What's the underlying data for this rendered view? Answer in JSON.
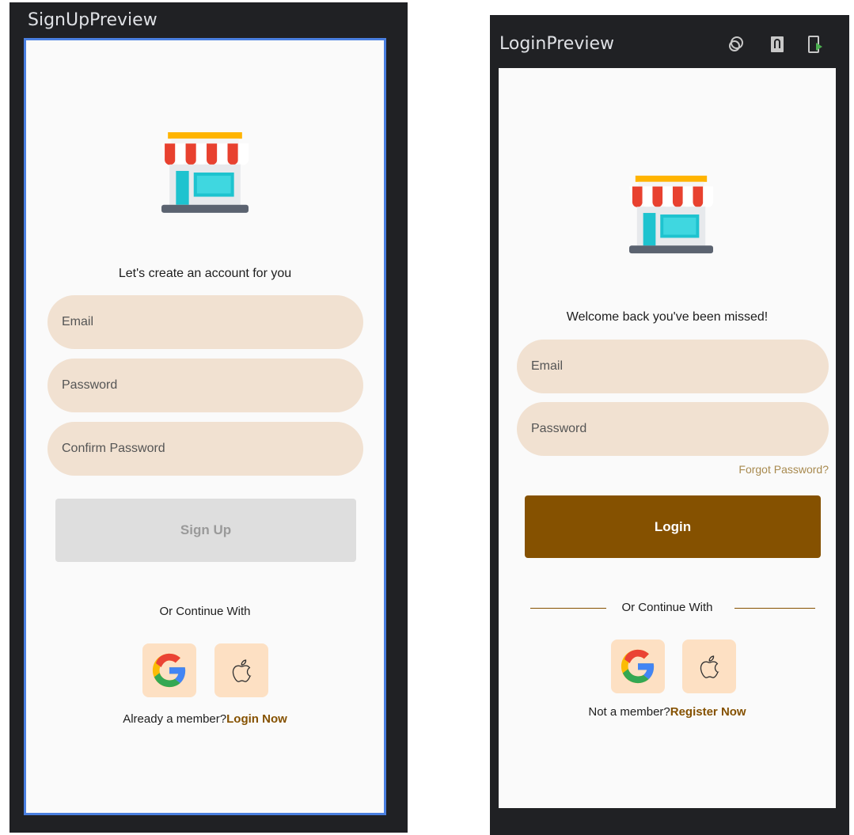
{
  "signup": {
    "title": "SignUpPreview",
    "heading": "Let's create an account for you",
    "fields": {
      "email": "Email",
      "password": "Password",
      "confirm": "Confirm Password"
    },
    "button": "Sign Up",
    "or_text": "Or Continue With",
    "footer_text": "Already a member?",
    "footer_link": "Login Now"
  },
  "login": {
    "title": "LoginPreview",
    "heading": "Welcome back you've been missed!",
    "fields": {
      "email": "Email",
      "password": "Password"
    },
    "forgot": "Forgot Password?",
    "button": "Login",
    "or_text": "Or Continue With",
    "footer_text": "Not a member?",
    "footer_link": "Register Now"
  },
  "toolbar_icons": [
    "interactive-mode-icon",
    "deploy-preview-icon",
    "run-on-device-icon"
  ],
  "colors": {
    "field_bg": "#f1e1d1",
    "primary": "#855100",
    "disabled_button": "#dedede",
    "social_bg": "#fde0c3",
    "selection": "#4a7fe0"
  }
}
